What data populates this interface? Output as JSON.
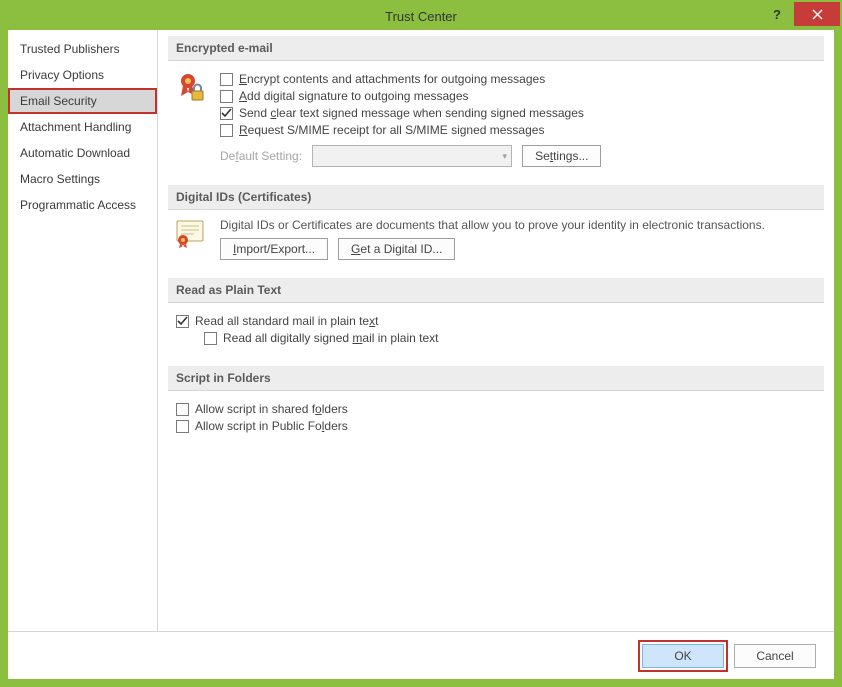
{
  "window": {
    "title": "Trust Center"
  },
  "sidebar": {
    "items": [
      {
        "label": "Trusted Publishers"
      },
      {
        "label": "Privacy Options"
      },
      {
        "label": "Email Security",
        "selected": true
      },
      {
        "label": "Attachment Handling"
      },
      {
        "label": "Automatic Download"
      },
      {
        "label": "Macro Settings"
      },
      {
        "label": "Programmatic Access"
      }
    ]
  },
  "sections": {
    "encrypted": {
      "title": "Encrypted e-mail",
      "opts": {
        "encrypt": "Encrypt contents and attachments for outgoing messages",
        "sign": "Add digital signature to outgoing messages",
        "cleartext": "Send clear text signed message when sending signed messages",
        "receipt": "Request S/MIME receipt for all S/MIME signed messages"
      },
      "default_label": "Default Setting:",
      "settings_btn": "Settings..."
    },
    "digital": {
      "title": "Digital IDs (Certificates)",
      "desc": "Digital IDs or Certificates are documents that allow you to prove your identity in electronic transactions.",
      "import_btn": "Import/Export...",
      "get_btn": "Get a Digital ID..."
    },
    "plaintext": {
      "title": "Read as Plain Text",
      "read_standard": "Read all standard mail in plain text",
      "read_signed": "Read all digitally signed mail in plain text"
    },
    "script": {
      "title": "Script in Folders",
      "shared": "Allow script in shared folders",
      "public": "Allow script in Public Folders"
    }
  },
  "footer": {
    "ok": "OK",
    "cancel": "Cancel"
  }
}
